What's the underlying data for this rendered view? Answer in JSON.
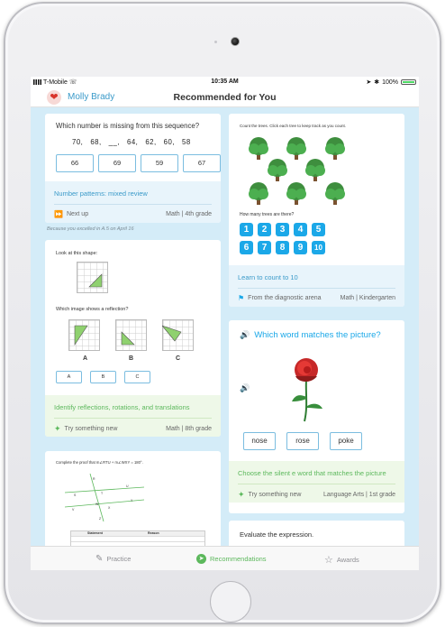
{
  "status_bar": {
    "carrier": "T-Mobile",
    "time": "10:35 AM",
    "battery": "100%"
  },
  "nav": {
    "user_name": "Molly Brady",
    "title": "Recommended for You"
  },
  "card1": {
    "question": "Which number is missing from this sequence?",
    "sequence": "70,   68,   __,   64,   62,   60,   58",
    "choices": [
      "66",
      "69",
      "59",
      "67"
    ],
    "skill": "Number patterns: mixed review",
    "action": "Next up",
    "subject": "Math | 4th grade",
    "note": "Because you excelled in A.5 on April 16"
  },
  "card2": {
    "prompt": "Look at this shape:",
    "question": "Which image shows a reflection?",
    "labels": [
      "A",
      "B",
      "C"
    ],
    "choices": [
      "A",
      "B",
      "C"
    ],
    "skill": "Identify reflections, rotations, and translations",
    "action": "Try something new",
    "subject": "Math | 8th grade"
  },
  "card3": {
    "prompt": "Complete the proof that m∠RTU + m∠WXY = 180°.",
    "table_headers": [
      "Statement",
      "Reason"
    ]
  },
  "card4": {
    "instruction": "Count the trees. Click each tree to keep track as you count.",
    "question": "How many trees are there?",
    "numbers": [
      "1",
      "2",
      "3",
      "4",
      "5",
      "6",
      "7",
      "8",
      "9",
      "10"
    ],
    "skill": "Learn to count to 10",
    "action": "From the diagnostic arena",
    "subject": "Math | Kindergarten"
  },
  "card5": {
    "question": "Which word matches the picture?",
    "choices": [
      "nose",
      "rose",
      "poke"
    ],
    "skill": "Choose the silent e word that matches the picture",
    "action": "Try something new",
    "subject": "Language Arts | 1st grade"
  },
  "card6": {
    "question": "Evaluate the expression."
  },
  "tabs": {
    "practice": "Practice",
    "recommendations": "Recommendations",
    "awards": "Awards"
  },
  "colors": {
    "accent_blue": "#3a9ac9",
    "accent_green": "#5cb85c",
    "background": "#d4ecf8",
    "button_blue": "#1ba8e8"
  }
}
